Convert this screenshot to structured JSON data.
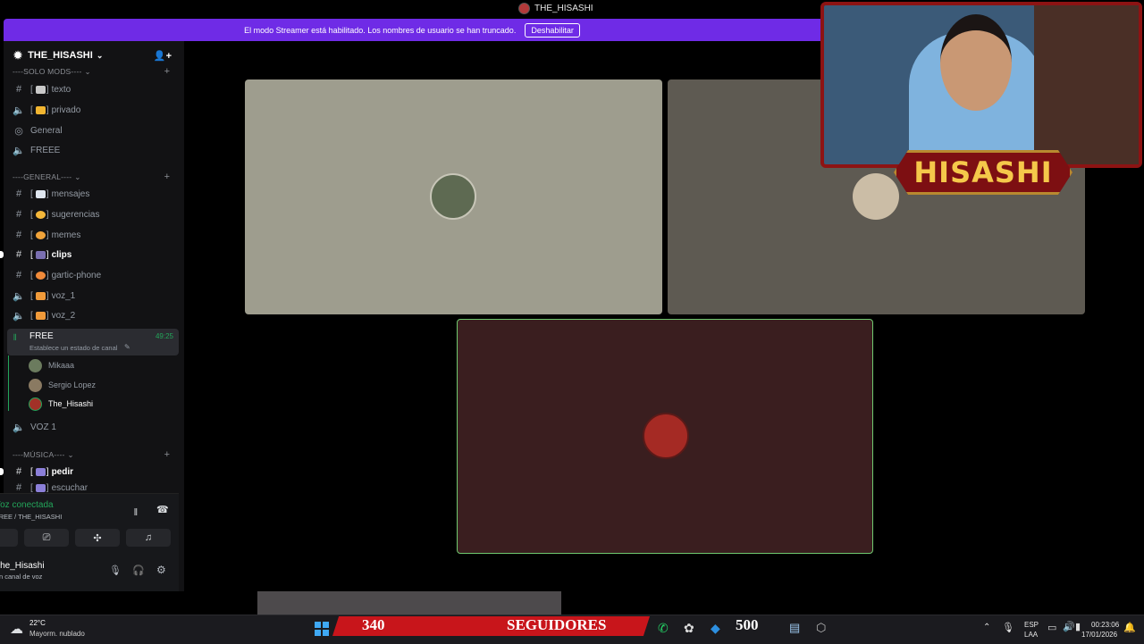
{
  "window": {
    "title": "THE_HISASHI"
  },
  "banner": {
    "message": "El modo Streamer está habilitado. Los nombres de usuario se han truncado.",
    "button": "Deshabilitar"
  },
  "server": {
    "name": "THE_HISASHI"
  },
  "categories": {
    "solo_mods": "----SOLO MODS----",
    "general": "----GENERAL----",
    "musica": "----MÚSICA----"
  },
  "channels": {
    "texto": "texto",
    "privado": "privado",
    "general_voice": "General",
    "freee": "FREEE",
    "mensajes": "mensajes",
    "sugerencias": "sugerencias",
    "memes": "memes",
    "clips": "clips",
    "gartic": "gartic-phone",
    "voz1": "voz_1",
    "voz2": "voz_2",
    "free": "FREE",
    "free_timer": "49:25",
    "free_status": "Establece un estado de canal",
    "voz_1_upper": "VOZ 1",
    "pedir": "pedir",
    "escuchar": "escuchar"
  },
  "members": [
    "Mikaaa",
    "Sergio Lopez",
    "The_Hisashi"
  ],
  "voice_panel": {
    "status": "Voz conectada",
    "location": "FREE / THE_HISASHI",
    "username": "The_Hisashi",
    "substatus": "En canal de voz"
  },
  "overlay": {
    "name": "HISASHI"
  },
  "stream_banner": {
    "count": "340",
    "label": "SEGUIDORES",
    "goal": "500"
  },
  "taskbar": {
    "weather_temp": "22°C",
    "weather_desc": "Mayorm. nublado",
    "lang": "ESP",
    "lang2": "LAA",
    "time": "00:23:06",
    "date": "17/01/2026"
  },
  "colors": {
    "accent": "#6f2be6",
    "voice_green": "#23a55a",
    "overlay_red": "#8d1313",
    "follower_red": "#c8151b"
  }
}
